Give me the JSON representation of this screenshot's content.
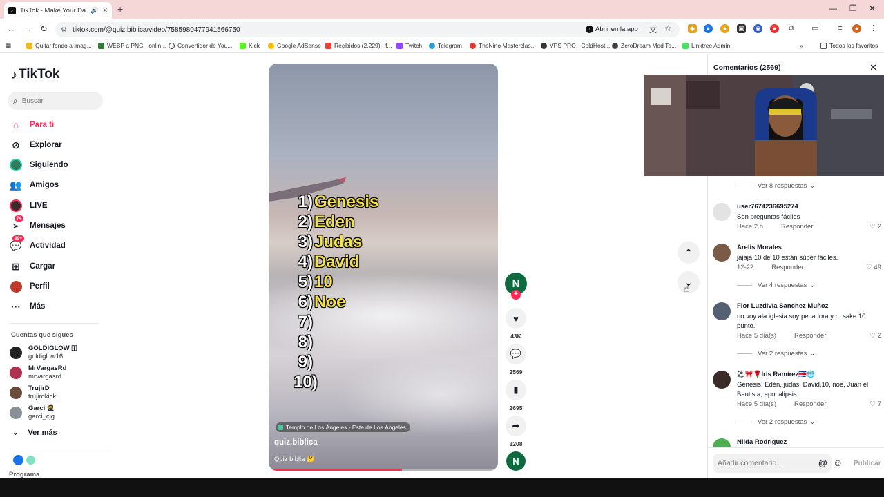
{
  "browser": {
    "tab_title": "TikTok - Make Your Day",
    "url": "tiktok.com/@quiz.biblica/video/7585980477941566750",
    "open_in_app": "Abrir en la app",
    "bookmarks": [
      "Quitar fondo a imag...",
      "WEBP a PNG - onlin...",
      "Convertidor de You...",
      "Kick",
      "Google AdSense",
      "Recibidos (2,229) - f...",
      "Twitch",
      "Telegram",
      "TheNino Masterclas...",
      "VPS PRO - ColdHost...",
      "ZeroDream Mod To...",
      "Linktree Admin"
    ],
    "all_bookmarks": "Todos los favoritos"
  },
  "sidebar": {
    "logo": "TikTok",
    "search_placeholder": "Buscar",
    "nav": [
      {
        "label": "Para ti",
        "active": true
      },
      {
        "label": "Explorar"
      },
      {
        "label": "Siguiendo"
      },
      {
        "label": "Amigos"
      },
      {
        "label": "LIVE"
      },
      {
        "label": "Mensajes",
        "badge": "74"
      },
      {
        "label": "Actividad",
        "badge": "99+"
      },
      {
        "label": "Cargar"
      },
      {
        "label": "Perfil"
      },
      {
        "label": "Más"
      }
    ],
    "following_title": "Cuentas que sigues",
    "accounts": [
      {
        "name": "GOLDIGLOW 🇮",
        "handle": "goldiglow16"
      },
      {
        "name": "MrVargasRd",
        "handle": "mrvargasrd"
      },
      {
        "name": "TrujirD",
        "handle": "trujirdkick"
      },
      {
        "name": "Garci 🥷",
        "handle": "garci_cjg"
      }
    ],
    "see_more": "Ver más",
    "footer_label": "Programa"
  },
  "video": {
    "answers": [
      {
        "n": "1)",
        "a": "Genesis"
      },
      {
        "n": "2)",
        "a": "Eden"
      },
      {
        "n": "3)",
        "a": "Judas"
      },
      {
        "n": "4)",
        "a": "David"
      },
      {
        "n": "5)",
        "a": "10"
      },
      {
        "n": "6)",
        "a": "Noe"
      },
      {
        "n": "7)",
        "a": ""
      },
      {
        "n": "8)",
        "a": ""
      },
      {
        "n": "9)",
        "a": ""
      },
      {
        "n": "10)",
        "a": ""
      }
    ],
    "location": "Templo de Los Ángeles - Este de Los Ángeles",
    "author": "quiz.biblica",
    "description": "Quiz biblia 🤔",
    "progress": 0.58,
    "creator_initial": "N"
  },
  "actions": {
    "likes": "43K",
    "comments": "2569",
    "saves": "2695",
    "shares": "3208"
  },
  "comments": {
    "title": "Comentarios (2569)",
    "view_replies_1": "Ver 8 respuestas",
    "items": [
      {
        "user": "user7674236695274",
        "text": "Son preguntas fáciles",
        "time": "Hace 2 h",
        "likes": "2",
        "replies": ""
      },
      {
        "user": "Arelis Morales",
        "text": "jajaja 10 de 10 están súper fáciles.",
        "time": "12-22",
        "likes": "49",
        "replies": "Ver 4 respuestas"
      },
      {
        "user": "Flor Luzdivia Sanchez Muñoz",
        "text": "no voy ala iglesia soy pecadora y m sake 10 punto.",
        "time": "Hace 5 día(s)",
        "likes": "2",
        "replies": "Ver 2 respuestas"
      },
      {
        "user": "⚽️🎀🌹Iris Ramírez🇨🇷🌐",
        "text": "Genesis, Edén, judas, David,10, noe, Juan el Bautista, apocalipsis",
        "time": "Hace 5 día(s)",
        "likes": "7",
        "replies": "Ver 2 respuestas"
      },
      {
        "user": "Nilda Rodriguez",
        "text": "",
        "time": "",
        "likes": "",
        "replies": ""
      }
    ],
    "reply_label": "Responder",
    "input_placeholder": "Añadir comentario...",
    "post_label": "Publicar"
  }
}
